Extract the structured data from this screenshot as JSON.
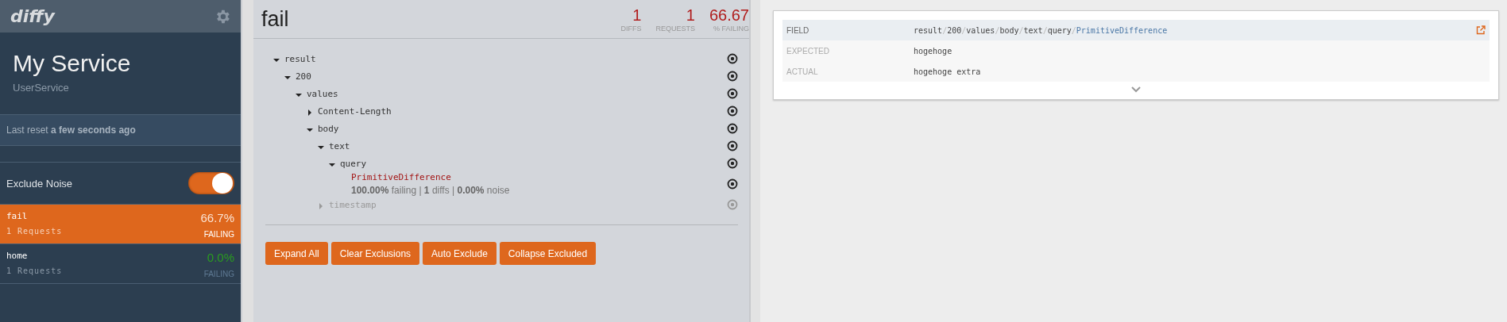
{
  "sidebar": {
    "logo": "diffy",
    "service_name": "My Service",
    "service_subtitle": "UserService",
    "last_reset": "Last reset **a few seconds ago**",
    "exclude_noise": {
      "label": "Exclude Noise",
      "on": true
    },
    "endpoints": [
      {
        "name": "fail",
        "requests": "1 Requests",
        "percent": "66.7%",
        "status": "FAILING",
        "selected": true,
        "failing": true
      },
      {
        "name": "home",
        "requests": "1 Requests",
        "percent": "0.0%",
        "status": "FAILING",
        "selected": false,
        "failing": false
      }
    ]
  },
  "main": {
    "title": "fail",
    "stats": [
      {
        "value": "1",
        "label": "DIFFS"
      },
      {
        "value": "1",
        "label": "REQUESTS"
      },
      {
        "value": "66.67",
        "label": "% FAILING"
      }
    ],
    "tree": [
      {
        "label": "result",
        "kind": "node",
        "expanded": true,
        "excluded": false,
        "children": [
          {
            "label": "200",
            "kind": "node",
            "expanded": true,
            "excluded": false,
            "children": [
              {
                "label": "values",
                "kind": "node",
                "expanded": true,
                "excluded": false,
                "children": [
                  {
                    "label": "Content-Length",
                    "kind": "node",
                    "expanded": false,
                    "excluded": false
                  },
                  {
                    "label": "body",
                    "kind": "node",
                    "expanded": true,
                    "excluded": false,
                    "children": [
                      {
                        "label": "text",
                        "kind": "node",
                        "expanded": true,
                        "excluded": false,
                        "children": [
                          {
                            "label": "query",
                            "kind": "node",
                            "expanded": true,
                            "excluded": false,
                            "children": [
                              {
                                "label": "PrimitiveDifference",
                                "kind": "difference",
                                "excluded": false,
                                "stats": "**100.00%** failing | **1** diffs | **0.00%** noise"
                              }
                            ]
                          }
                        ]
                      },
                      {
                        "label": "timestamp",
                        "kind": "node",
                        "expanded": false,
                        "excluded": true
                      }
                    ]
                  }
                ]
              }
            ]
          }
        ]
      }
    ],
    "buttons": [
      "Expand All",
      "Clear Exclusions",
      "Auto Exclude",
      "Collapse Excluded"
    ]
  },
  "detail": {
    "field_label": "FIELD",
    "field_path": [
      "result",
      "200",
      "values",
      "body",
      "text",
      "query",
      "PrimitiveDifference"
    ],
    "separator": "/",
    "rows": [
      {
        "label": "EXPECTED",
        "value": "hogehoge"
      },
      {
        "label": "ACTUAL",
        "value": "hogehoge extra"
      }
    ]
  }
}
